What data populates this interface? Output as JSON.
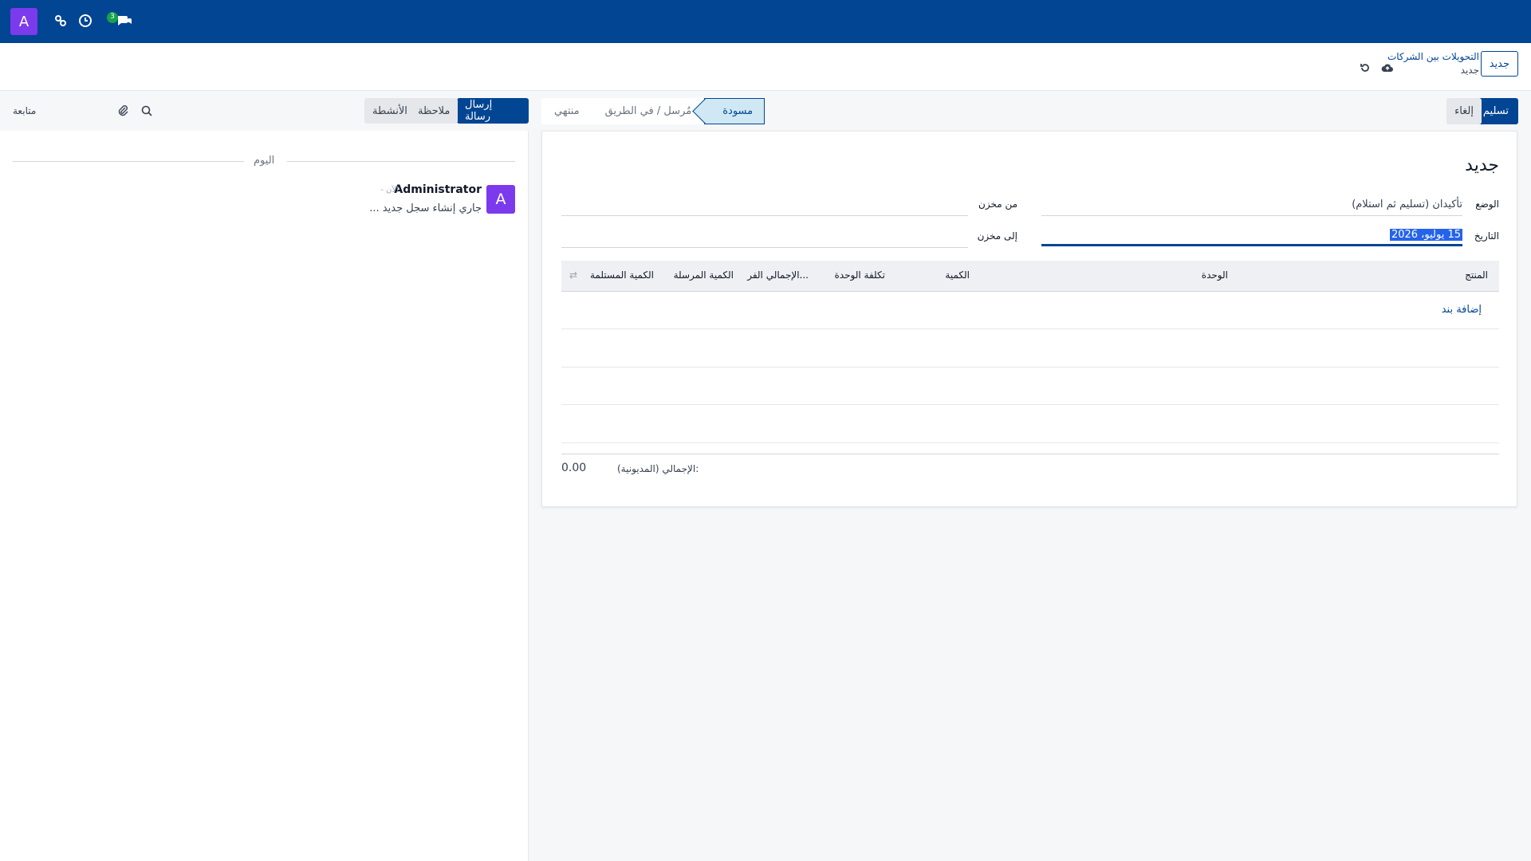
{
  "topbar": {
    "user_initial": "A",
    "chat_badge": "3",
    "icons": [
      "avatar",
      "settings-share-icon",
      "clock-icon",
      "chat-icon"
    ]
  },
  "control": {
    "new_button": "جديد",
    "breadcrumb_parent": "التحويلات بين الشركات",
    "breadcrumb_current": "جديد"
  },
  "statusbar": {
    "confirm_button": "تسليم",
    "cancel_button": "إلغاء",
    "stages": [
      "مسودة",
      "مُرسل / في الطريق",
      "منتهي"
    ],
    "active_stage": "مسودة"
  },
  "form": {
    "title": "جديد",
    "state_label": "الوضع",
    "state_value": "تأكيدان (تسليم ثم استلام)",
    "date_label": "التاريخ",
    "date_value": "15 يوليو، 2026",
    "from_warehouse_label": "من مخزن",
    "to_warehouse_label": "إلى مخزن",
    "columns": [
      "المنتج",
      "الوحدة",
      "الكمية",
      "تكلفة الوحدة",
      "الإجمالي الفر...",
      "الكمية المرسلة",
      "الكمية المستلمة"
    ],
    "add_line": "إضافة بند",
    "total_label": "الإجمالي (المديونية):",
    "total_value": "0.00"
  },
  "chatter": {
    "send_message": "إرسال رسالة",
    "log_note": "ملاحظة",
    "activities": "الأنشطة",
    "follow": "متابعة",
    "today": "اليوم",
    "author": "Administrator",
    "time": "- الآن",
    "body": "جاري إنشاء سجل جديد ...",
    "author_initial": "A"
  },
  "colors": {
    "brand": "#024593",
    "avatar": "#7c3aed",
    "badge": "#16a34a"
  }
}
